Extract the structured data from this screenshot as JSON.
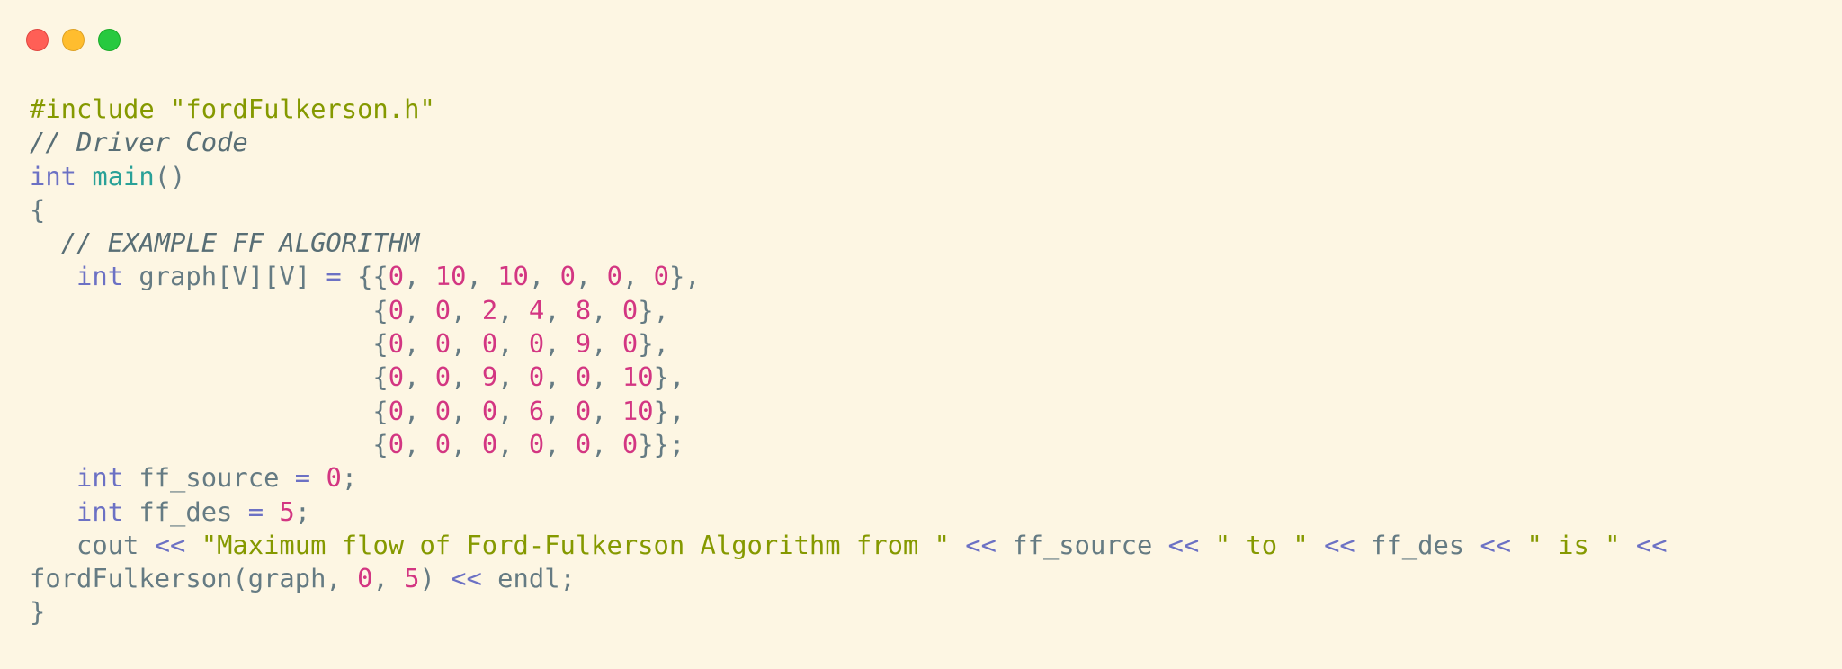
{
  "window": {
    "controls": [
      "close",
      "minimize",
      "maximize"
    ],
    "control_colors": {
      "close": "#ff5f56",
      "minimize": "#ffbd2e",
      "maximize": "#27c93f"
    },
    "background": "#fdf6e3"
  },
  "code": {
    "language": "cpp",
    "lines": [
      [
        {
          "t": "pp",
          "v": "#include "
        },
        {
          "t": "str",
          "v": "\"fordFulkerson.h\""
        }
      ],
      [
        {
          "t": "cmt",
          "v": "// Driver Code"
        }
      ],
      [
        {
          "t": "kw",
          "v": "int"
        },
        {
          "t": "txt",
          "v": " "
        },
        {
          "t": "fn",
          "v": "main"
        },
        {
          "t": "txt",
          "v": "()"
        }
      ],
      [
        {
          "t": "txt",
          "v": "{"
        }
      ],
      [
        {
          "t": "txt",
          "v": "  "
        },
        {
          "t": "cmt",
          "v": "// EXAMPLE FF ALGORITHM"
        }
      ],
      [
        {
          "t": "txt",
          "v": "   "
        },
        {
          "t": "kw",
          "v": "int"
        },
        {
          "t": "txt",
          "v": " graph[V][V] "
        },
        {
          "t": "op",
          "v": "="
        },
        {
          "t": "txt",
          "v": " {{"
        },
        {
          "t": "num",
          "v": "0"
        },
        {
          "t": "txt",
          "v": ", "
        },
        {
          "t": "num",
          "v": "10"
        },
        {
          "t": "txt",
          "v": ", "
        },
        {
          "t": "num",
          "v": "10"
        },
        {
          "t": "txt",
          "v": ", "
        },
        {
          "t": "num",
          "v": "0"
        },
        {
          "t": "txt",
          "v": ", "
        },
        {
          "t": "num",
          "v": "0"
        },
        {
          "t": "txt",
          "v": ", "
        },
        {
          "t": "num",
          "v": "0"
        },
        {
          "t": "txt",
          "v": "},"
        }
      ],
      [
        {
          "t": "txt",
          "v": "                      {"
        },
        {
          "t": "num",
          "v": "0"
        },
        {
          "t": "txt",
          "v": ", "
        },
        {
          "t": "num",
          "v": "0"
        },
        {
          "t": "txt",
          "v": ", "
        },
        {
          "t": "num",
          "v": "2"
        },
        {
          "t": "txt",
          "v": ", "
        },
        {
          "t": "num",
          "v": "4"
        },
        {
          "t": "txt",
          "v": ", "
        },
        {
          "t": "num",
          "v": "8"
        },
        {
          "t": "txt",
          "v": ", "
        },
        {
          "t": "num",
          "v": "0"
        },
        {
          "t": "txt",
          "v": "},"
        }
      ],
      [
        {
          "t": "txt",
          "v": "                      {"
        },
        {
          "t": "num",
          "v": "0"
        },
        {
          "t": "txt",
          "v": ", "
        },
        {
          "t": "num",
          "v": "0"
        },
        {
          "t": "txt",
          "v": ", "
        },
        {
          "t": "num",
          "v": "0"
        },
        {
          "t": "txt",
          "v": ", "
        },
        {
          "t": "num",
          "v": "0"
        },
        {
          "t": "txt",
          "v": ", "
        },
        {
          "t": "num",
          "v": "9"
        },
        {
          "t": "txt",
          "v": ", "
        },
        {
          "t": "num",
          "v": "0"
        },
        {
          "t": "txt",
          "v": "},"
        }
      ],
      [
        {
          "t": "txt",
          "v": "                      {"
        },
        {
          "t": "num",
          "v": "0"
        },
        {
          "t": "txt",
          "v": ", "
        },
        {
          "t": "num",
          "v": "0"
        },
        {
          "t": "txt",
          "v": ", "
        },
        {
          "t": "num",
          "v": "9"
        },
        {
          "t": "txt",
          "v": ", "
        },
        {
          "t": "num",
          "v": "0"
        },
        {
          "t": "txt",
          "v": ", "
        },
        {
          "t": "num",
          "v": "0"
        },
        {
          "t": "txt",
          "v": ", "
        },
        {
          "t": "num",
          "v": "10"
        },
        {
          "t": "txt",
          "v": "},"
        }
      ],
      [
        {
          "t": "txt",
          "v": "                      {"
        },
        {
          "t": "num",
          "v": "0"
        },
        {
          "t": "txt",
          "v": ", "
        },
        {
          "t": "num",
          "v": "0"
        },
        {
          "t": "txt",
          "v": ", "
        },
        {
          "t": "num",
          "v": "0"
        },
        {
          "t": "txt",
          "v": ", "
        },
        {
          "t": "num",
          "v": "6"
        },
        {
          "t": "txt",
          "v": ", "
        },
        {
          "t": "num",
          "v": "0"
        },
        {
          "t": "txt",
          "v": ", "
        },
        {
          "t": "num",
          "v": "10"
        },
        {
          "t": "txt",
          "v": "},"
        }
      ],
      [
        {
          "t": "txt",
          "v": "                      {"
        },
        {
          "t": "num",
          "v": "0"
        },
        {
          "t": "txt",
          "v": ", "
        },
        {
          "t": "num",
          "v": "0"
        },
        {
          "t": "txt",
          "v": ", "
        },
        {
          "t": "num",
          "v": "0"
        },
        {
          "t": "txt",
          "v": ", "
        },
        {
          "t": "num",
          "v": "0"
        },
        {
          "t": "txt",
          "v": ", "
        },
        {
          "t": "num",
          "v": "0"
        },
        {
          "t": "txt",
          "v": ", "
        },
        {
          "t": "num",
          "v": "0"
        },
        {
          "t": "txt",
          "v": "}};"
        }
      ],
      [
        {
          "t": "txt",
          "v": "   "
        },
        {
          "t": "kw",
          "v": "int"
        },
        {
          "t": "txt",
          "v": " ff_source "
        },
        {
          "t": "op",
          "v": "="
        },
        {
          "t": "txt",
          "v": " "
        },
        {
          "t": "num",
          "v": "0"
        },
        {
          "t": "txt",
          "v": ";"
        }
      ],
      [
        {
          "t": "txt",
          "v": "   "
        },
        {
          "t": "kw",
          "v": "int"
        },
        {
          "t": "txt",
          "v": " ff_des "
        },
        {
          "t": "op",
          "v": "="
        },
        {
          "t": "txt",
          "v": " "
        },
        {
          "t": "num",
          "v": "5"
        },
        {
          "t": "txt",
          "v": ";"
        }
      ],
      [
        {
          "t": "txt",
          "v": "   cout "
        },
        {
          "t": "op",
          "v": "<<"
        },
        {
          "t": "txt",
          "v": " "
        },
        {
          "t": "str",
          "v": "\"Maximum flow of Ford-Fulkerson Algorithm from \""
        },
        {
          "t": "txt",
          "v": " "
        },
        {
          "t": "op",
          "v": "<<"
        },
        {
          "t": "txt",
          "v": " ff_source "
        },
        {
          "t": "op",
          "v": "<<"
        },
        {
          "t": "txt",
          "v": " "
        },
        {
          "t": "str",
          "v": "\" to \""
        },
        {
          "t": "txt",
          "v": " "
        },
        {
          "t": "op",
          "v": "<<"
        },
        {
          "t": "txt",
          "v": " ff_des "
        },
        {
          "t": "op",
          "v": "<<"
        },
        {
          "t": "txt",
          "v": " "
        },
        {
          "t": "str",
          "v": "\" is \""
        },
        {
          "t": "txt",
          "v": " "
        },
        {
          "t": "op",
          "v": "<<"
        }
      ],
      [
        {
          "t": "txt",
          "v": "fordFulkerson(graph, "
        },
        {
          "t": "num",
          "v": "0"
        },
        {
          "t": "txt",
          "v": ", "
        },
        {
          "t": "num",
          "v": "5"
        },
        {
          "t": "txt",
          "v": ") "
        },
        {
          "t": "op",
          "v": "<<"
        },
        {
          "t": "txt",
          "v": " endl;"
        }
      ],
      [
        {
          "t": "txt",
          "v": "}"
        }
      ]
    ]
  }
}
